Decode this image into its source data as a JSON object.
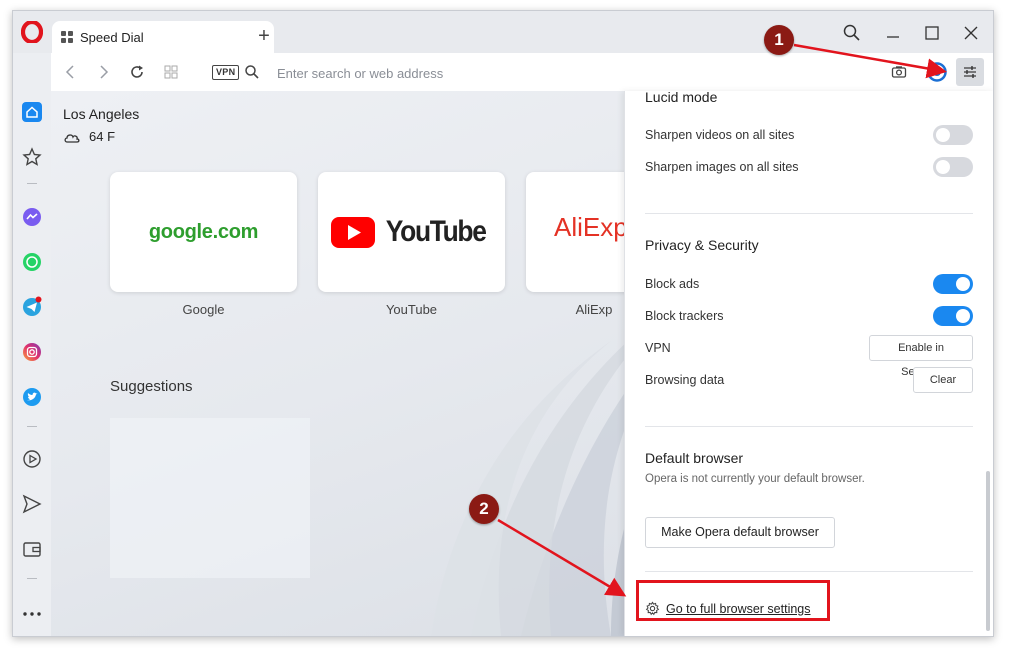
{
  "browser": {
    "tab_title": "Speed Dial",
    "new_tab_symbol": "+",
    "vpn_badge": "VPN",
    "search_placeholder": "Enter search or web address"
  },
  "weather": {
    "city": "Los Angeles",
    "temperature": "64 F",
    "icon": "cloud-icon"
  },
  "speed_dial": {
    "tiles": [
      {
        "caption": "Google",
        "logo_text": "google.com"
      },
      {
        "caption": "YouTube",
        "logo_text": "YouTube"
      },
      {
        "caption": "AliExp",
        "logo_text": "AliExp"
      }
    ],
    "suggestions_title": "Suggestions"
  },
  "sidebar": {
    "items": [
      "home-icon",
      "bookmarks-icon",
      "messenger-icon",
      "whatsapp-icon",
      "telegram-icon",
      "instagram-icon",
      "twitter-icon",
      "player-icon",
      "send-icon",
      "wallet-icon",
      "more-icon"
    ]
  },
  "panel": {
    "lucid_title": "Lucid mode",
    "sharpen_videos": "Sharpen videos on all sites",
    "sharpen_images": "Sharpen images on all sites",
    "privacy_title": "Privacy & Security",
    "block_ads": "Block ads",
    "block_trackers": "Block trackers",
    "vpn": "VPN",
    "vpn_button": "Enable in Settings",
    "browsing_data": "Browsing data",
    "clear_button": "Clear",
    "default_title": "Default browser",
    "default_desc": "Opera is not currently your default browser.",
    "default_button": "Make Opera default browser",
    "settings_link": "Go to full browser settings"
  },
  "toggles": {
    "sharpen_videos": false,
    "sharpen_images": false,
    "block_ads": true,
    "block_trackers": true
  },
  "annotations": {
    "marker_1": "1",
    "marker_2": "2",
    "arrow_color": "#e2141d",
    "marker_color": "#8b1a14"
  },
  "colors": {
    "opera_red": "#e1141d",
    "toggle_on": "#1a88f0",
    "google_green": "#2e9e2e",
    "youtube_red": "#ff0000",
    "aliexpress_red": "#e43225"
  }
}
